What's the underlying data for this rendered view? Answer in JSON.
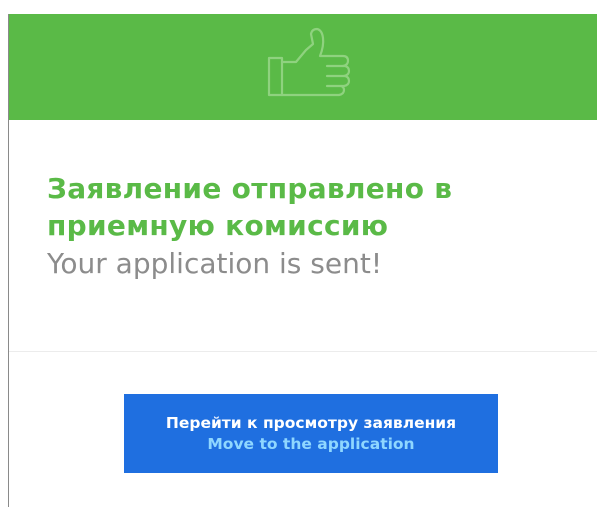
{
  "banner": {
    "icon": "thumbs-up-icon",
    "background_color": "#5aba47"
  },
  "message": {
    "title_ru": "Заявление отправлено в приемную комиссию",
    "title_en": "Your application is sent!"
  },
  "button": {
    "label_ru": "Перейти к просмотру заявления",
    "label_en": "Move to the application",
    "background_color": "#1f6fe0"
  }
}
